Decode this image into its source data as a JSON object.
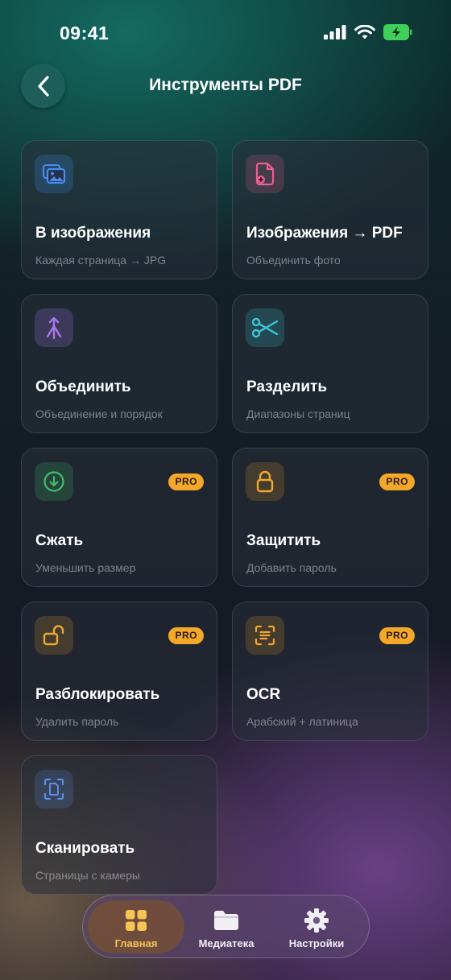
{
  "status_bar": {
    "time": "09:41"
  },
  "header": {
    "title": "Инструменты PDF"
  },
  "tools": [
    {
      "title": "В изображения",
      "subtitle": "Каждая страница → JPG",
      "icon": "image-icon",
      "pro": false,
      "color": "#4a8df0"
    },
    {
      "title": "Изображения → PDF",
      "subtitle": "Объединить фото",
      "icon": "add-document-icon",
      "pro": false,
      "color": "#e8608f"
    },
    {
      "title": "Объединить",
      "subtitle": "Объединение и порядок",
      "icon": "merge-icon",
      "pro": false,
      "color": "#a878ee"
    },
    {
      "title": "Разделить",
      "subtitle": "Диапазоны страниц",
      "icon": "scissors-icon",
      "pro": false,
      "color": "#3ec7d8"
    },
    {
      "title": "Сжать",
      "subtitle": "Уменьшить размер",
      "icon": "download-circle-icon",
      "pro": true,
      "color": "#3fbf6a"
    },
    {
      "title": "Защитить",
      "subtitle": "Добавить пароль",
      "icon": "lock-icon",
      "pro": true,
      "color": "#f0a82c"
    },
    {
      "title": "Разблокировать",
      "subtitle": "Удалить пароль",
      "icon": "unlock-icon",
      "pro": true,
      "color": "#f0a82c"
    },
    {
      "title": "OCR",
      "subtitle": "Арабский + латиница",
      "icon": "text-scan-icon",
      "pro": true,
      "color": "#f0a82c"
    },
    {
      "title": "Сканировать",
      "subtitle": "Страницы с камеры",
      "icon": "document-scan-icon",
      "pro": false,
      "color": "#5a8ee8"
    }
  ],
  "pro_badge_label": "PRO",
  "tab_bar": {
    "tabs": [
      {
        "label": "Главная",
        "icon": "grid-icon",
        "active": true
      },
      {
        "label": "Медиатека",
        "icon": "folder-icon",
        "active": false
      },
      {
        "label": "Настройки",
        "icon": "gear-icon",
        "active": false
      }
    ]
  }
}
